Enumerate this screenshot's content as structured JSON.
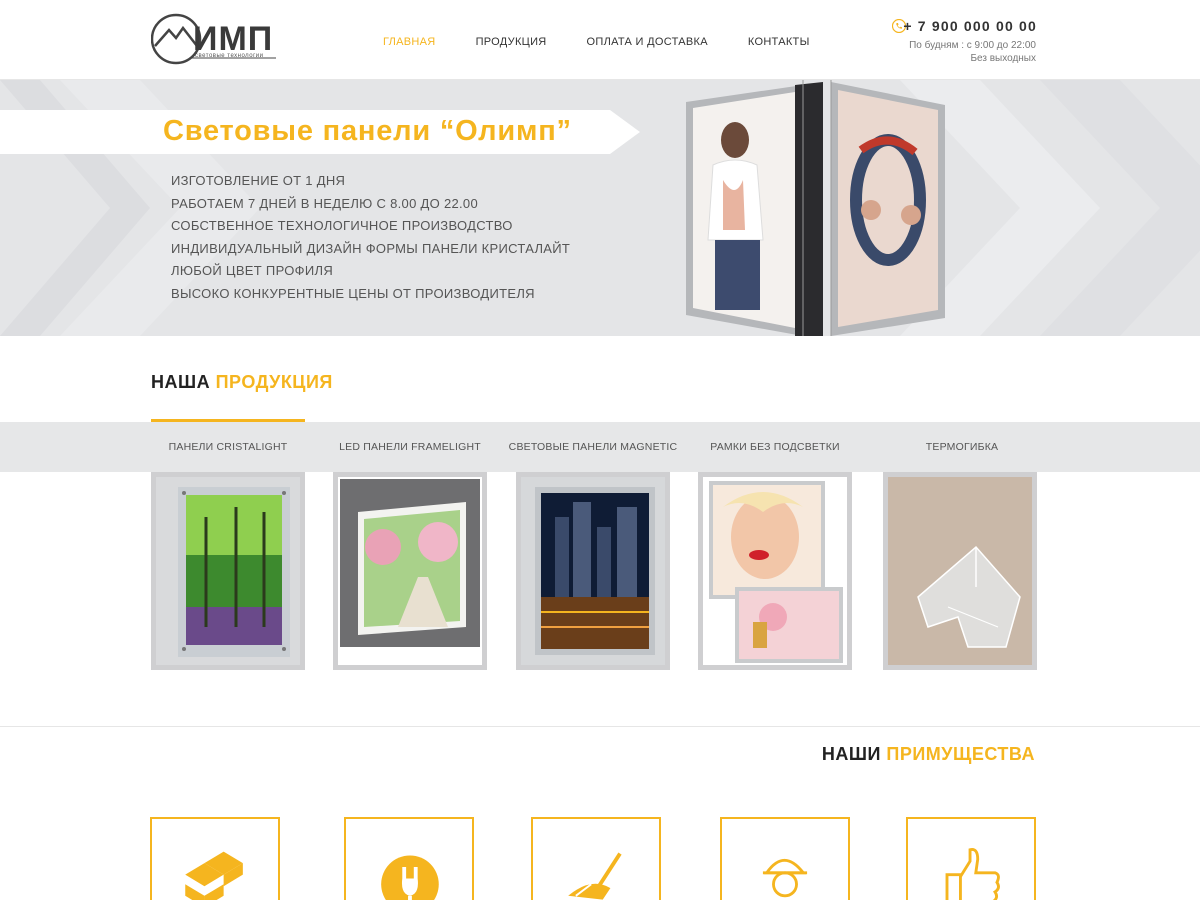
{
  "header": {
    "logo_word": "ИМП",
    "logo_sub": "световые технологии",
    "nav": [
      "Главная",
      "Продукция",
      "Оплата и доставка",
      "Контакты"
    ],
    "phone": "+ 7 900 000 00 00",
    "hours_line1": "По будням : с 9:00 до 22:00",
    "hours_line2": "Без выходных"
  },
  "hero": {
    "title": "Световые панели “Олимп”",
    "features": [
      "Изготовление от 1 дня",
      "Работаем 7 дней в неделю с 8.00 до 22.00",
      "Собственное технологичное производство",
      "Индивидуальный дизайн формы панели Кристалайт",
      "Любой цвет профиля",
      "Высоко конкурентные цены от производителя"
    ]
  },
  "products": {
    "title_part1": "Наша",
    "title_part2": "продукция",
    "tabs": [
      "Панели Cristalight",
      "LED панели Framelight",
      "Световые панели Magnetic",
      "Рамки  без подсветки",
      "Термогибка"
    ]
  },
  "advantages": {
    "title_part1": "Наши",
    "title_part2": "примущества",
    "icons": [
      "stack-icon",
      "plug-icon",
      "broom-icon",
      "worker-icon",
      "thumbs-up-icon"
    ]
  },
  "colors": {
    "accent": "#f5b51f",
    "text": "#333333",
    "hero_bg": "#e4e5e7",
    "tab_bar": "#e6e7e8"
  }
}
